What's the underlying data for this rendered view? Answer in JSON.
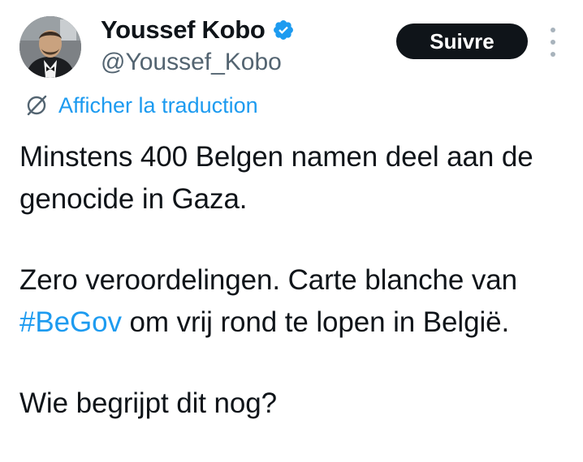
{
  "author": {
    "display_name": "Youssef Kobo",
    "handle": "@Youssef_Kobo",
    "verified": true
  },
  "actions": {
    "follow_label": "Suivre",
    "more_icon": "more-vertical-icon"
  },
  "translation": {
    "label": "Afficher la traduction",
    "icon": "translate-globe-icon"
  },
  "tweet": {
    "line1": "Minstens 400 Belgen namen deel aan de genocide in Gaza.",
    "line2_before": "Zero veroordelingen. Carte blanche van ",
    "line2_hashtag": "#BeGov",
    "line2_after": " om vrij rond te lopen in België.",
    "line3": "Wie begrijpt dit nog?"
  },
  "colors": {
    "link": "#1d9bf0",
    "text": "#0f1419",
    "secondary": "#536471",
    "button_bg": "#0f1419",
    "button_text": "#ffffff",
    "verified_badge": "#1d9bf0"
  }
}
